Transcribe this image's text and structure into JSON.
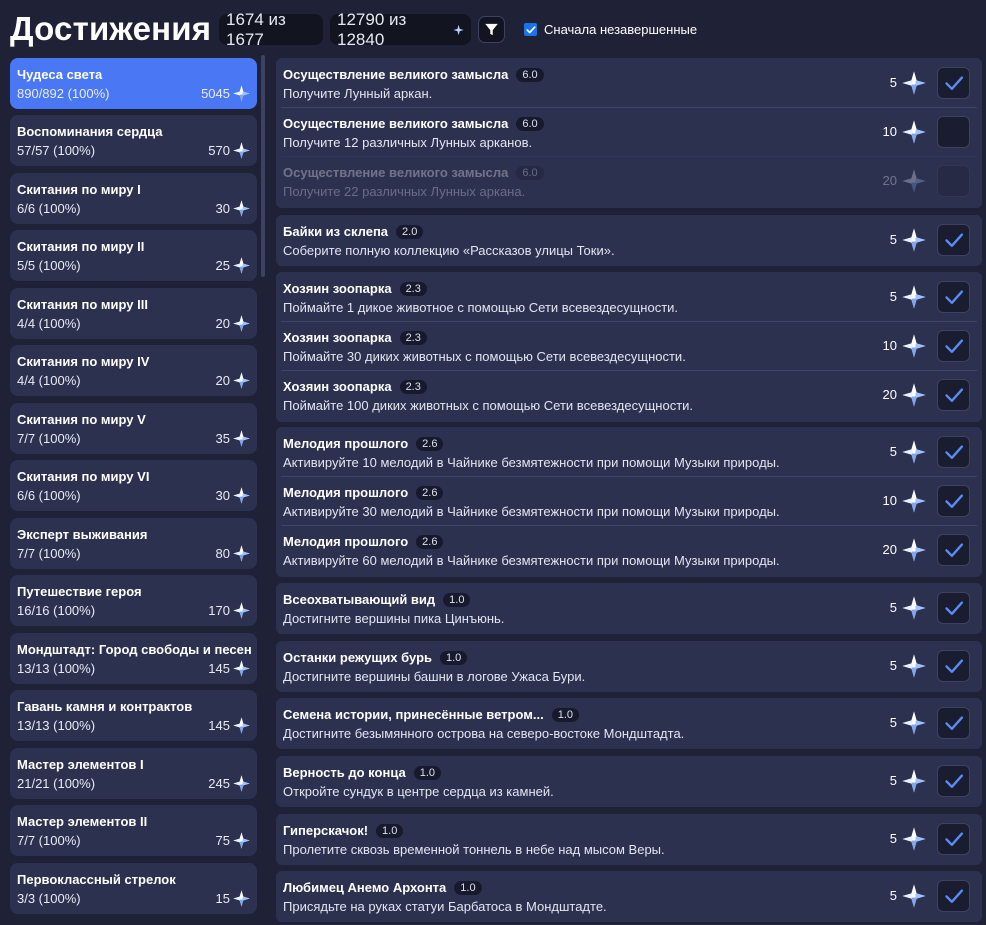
{
  "header": {
    "title": "Достижения",
    "count_text": "1674 из 1677",
    "gems_text": "12790 из 12840",
    "filter_icon": "filter-icon",
    "sort_label": "Сначала незавершенные",
    "sort_checked": true
  },
  "colors": {
    "background": "#1f2237",
    "card": "#2c3150",
    "active": "#4a78f5",
    "check": "#5a8cf7"
  },
  "sidebar": {
    "items": [
      {
        "name": "Чудеса света",
        "progress": "890/892 (100%)",
        "points": "5045",
        "active": true
      },
      {
        "name": "Воспоминания сердца",
        "progress": "57/57 (100%)",
        "points": "570"
      },
      {
        "name": "Скитания по миру I",
        "progress": "6/6 (100%)",
        "points": "30"
      },
      {
        "name": "Скитания по миру II",
        "progress": "5/5 (100%)",
        "points": "25"
      },
      {
        "name": "Скитания по миру III",
        "progress": "4/4 (100%)",
        "points": "20"
      },
      {
        "name": "Скитания по миру IV",
        "progress": "4/4 (100%)",
        "points": "20"
      },
      {
        "name": "Скитания по миру V",
        "progress": "7/7 (100%)",
        "points": "35"
      },
      {
        "name": "Скитания по миру VI",
        "progress": "6/6 (100%)",
        "points": "30"
      },
      {
        "name": "Эксперт выживания",
        "progress": "7/7 (100%)",
        "points": "80"
      },
      {
        "name": "Путешествие героя",
        "progress": "16/16 (100%)",
        "points": "170"
      },
      {
        "name": "Мондштадт: Город свободы и песен",
        "progress": "13/13 (100%)",
        "points": "145"
      },
      {
        "name": "Гавань камня и контрактов",
        "progress": "13/13 (100%)",
        "points": "145"
      },
      {
        "name": "Мастер элементов I",
        "progress": "21/21 (100%)",
        "points": "245"
      },
      {
        "name": "Мастер элементов II",
        "progress": "7/7 (100%)",
        "points": "75"
      },
      {
        "name": "Первоклассный стрелок",
        "progress": "3/3 (100%)",
        "points": "15"
      }
    ]
  },
  "achievements": {
    "groups": [
      {
        "items": [
          {
            "title": "Осуществление великого замысла",
            "version": "6.0",
            "desc": "Получите Лунный аркан.",
            "points": "5",
            "done": true
          },
          {
            "title": "Осуществление великого замысла",
            "version": "6.0",
            "desc": "Получите 12 различных Лунных арканов.",
            "points": "10",
            "done": false
          },
          {
            "title": "Осуществление великого замысла",
            "version": "6.0",
            "desc": "Получите 22 различных Лунных аркана.",
            "points": "20",
            "done": false,
            "dim": true
          }
        ]
      },
      {
        "items": [
          {
            "title": "Байки из склепа",
            "version": "2.0",
            "desc": "Соберите полную коллекцию «Рассказов улицы Токи».",
            "points": "5",
            "done": true
          }
        ]
      },
      {
        "items": [
          {
            "title": "Хозяин зоопарка",
            "version": "2.3",
            "desc": "Поймайте 1 дикое животное с помощью Сети вcевездесущности.",
            "points": "5",
            "done": true
          },
          {
            "title": "Хозяин зоопарка",
            "version": "2.3",
            "desc": "Поймайте 30 диких животных с помощью Сети вcевездесущности.",
            "points": "10",
            "done": true
          },
          {
            "title": "Хозяин зоопарка",
            "version": "2.3",
            "desc": "Поймайте 100 диких животных с помощью Сети вcевездесущности.",
            "points": "20",
            "done": true
          }
        ]
      },
      {
        "items": [
          {
            "title": "Мелодия прошлого",
            "version": "2.6",
            "desc": "Активируйте 10 мелодий в Чайнике безмятежности при помощи Музыки природы.",
            "points": "5",
            "done": true
          },
          {
            "title": "Мелодия прошлого",
            "version": "2.6",
            "desc": "Активируйте 30 мелодий в Чайнике безмятежности при помощи Музыки природы.",
            "points": "10",
            "done": true
          },
          {
            "title": "Мелодия прошлого",
            "version": "2.6",
            "desc": "Активируйте 60 мелодий в Чайнике безмятежности при помощи Музыки природы.",
            "points": "20",
            "done": true
          }
        ]
      },
      {
        "items": [
          {
            "title": "Всеохватывающий вид",
            "version": "1.0",
            "desc": "Достигните вершины пика Цинъюнь.",
            "points": "5",
            "done": true
          }
        ]
      },
      {
        "items": [
          {
            "title": "Останки режущих бурь",
            "version": "1.0",
            "desc": "Достигните вершины башни в логове Ужаса Бури.",
            "points": "5",
            "done": true
          }
        ]
      },
      {
        "items": [
          {
            "title": "Семена истории, принесённые ветром...",
            "version": "1.0",
            "desc": "Достигните безымянного острова на северо-востоке Мондштадта.",
            "points": "5",
            "done": true
          }
        ]
      },
      {
        "items": [
          {
            "title": "Верность до конца",
            "version": "1.0",
            "desc": "Откройте сундук в центре сердца из камней.",
            "points": "5",
            "done": true
          }
        ]
      },
      {
        "items": [
          {
            "title": "Гиперскачок!",
            "version": "1.0",
            "desc": "Пролетите сквозь временной тоннель в небе над мысом Веры.",
            "points": "5",
            "done": true
          }
        ]
      },
      {
        "items": [
          {
            "title": "Любимец Анемо Архонта",
            "version": "1.0",
            "desc": "Присядьте на руках статуи Барбатоса в Мондштадте.",
            "points": "5",
            "done": true
          }
        ]
      }
    ]
  }
}
